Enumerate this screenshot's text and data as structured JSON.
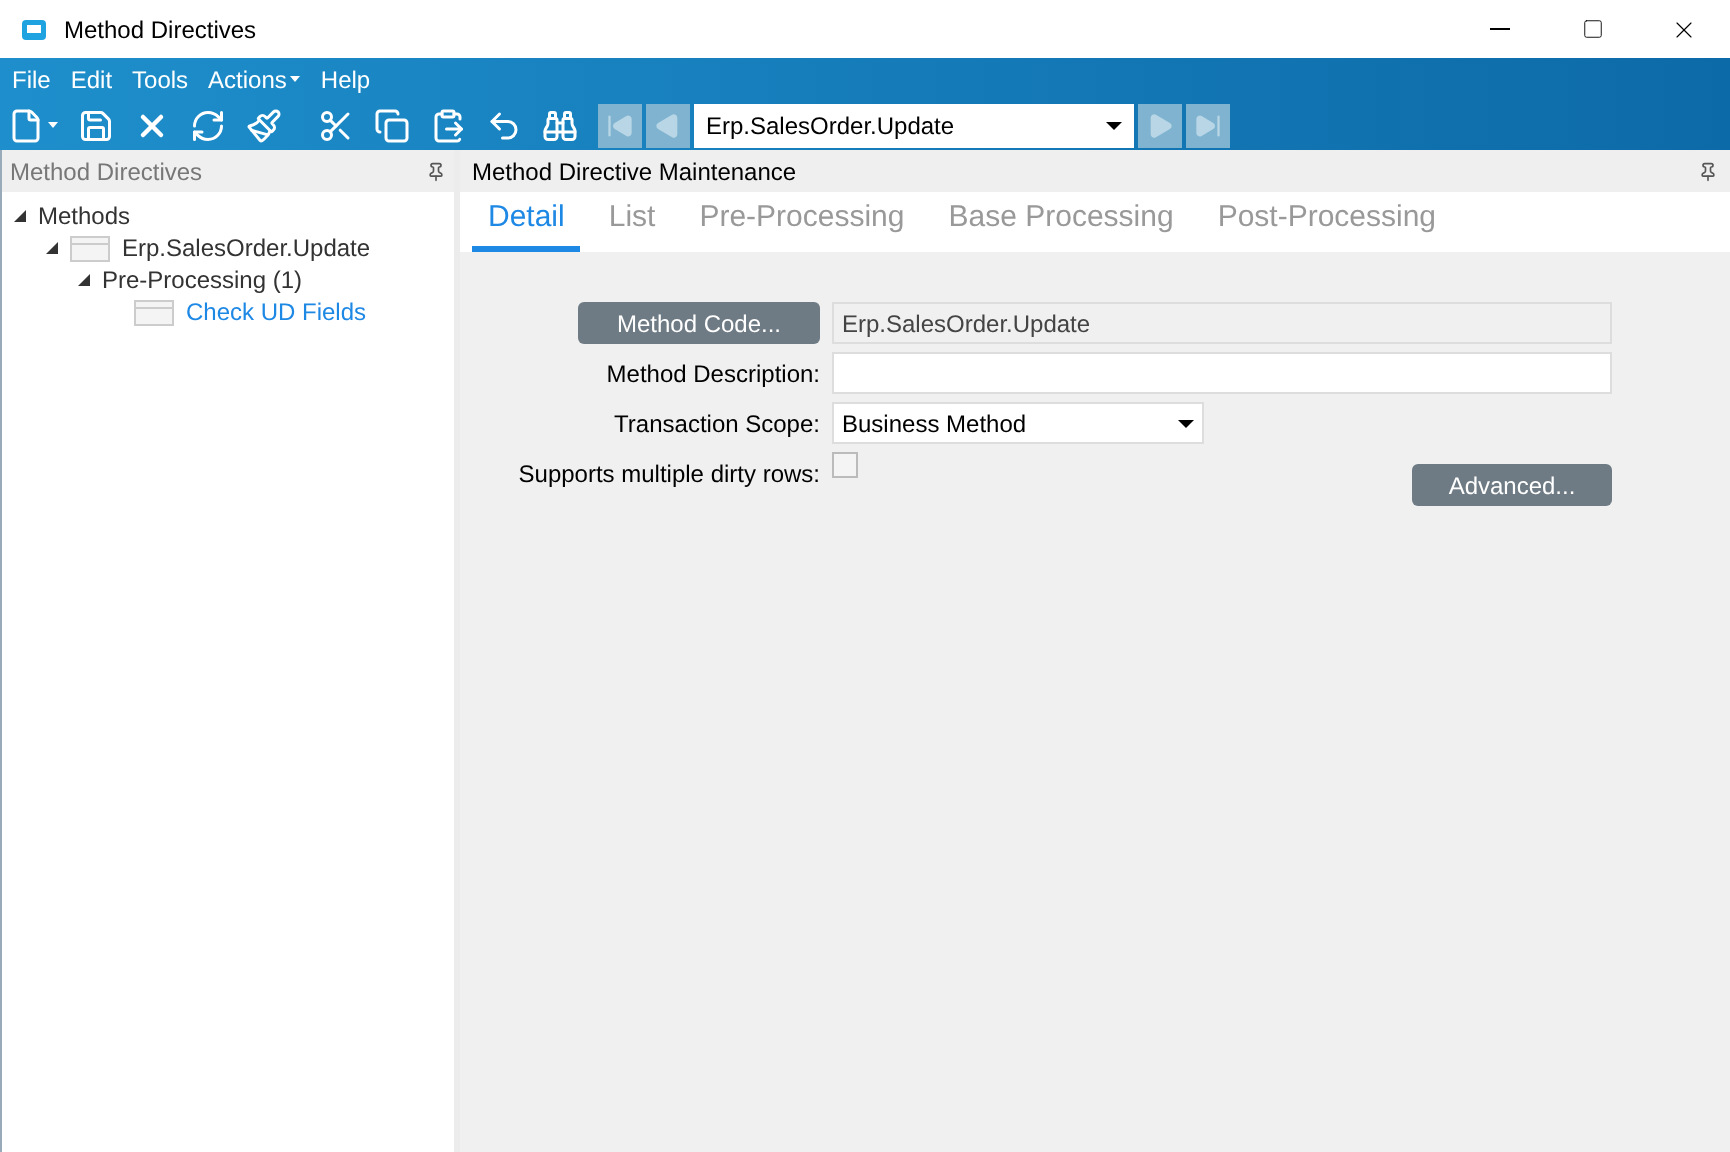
{
  "window": {
    "title": "Method Directives"
  },
  "menu": [
    "File",
    "Edit",
    "Tools",
    "Actions",
    "Help"
  ],
  "toolbar": {
    "record": "Erp.SalesOrder.Update"
  },
  "left_panel": {
    "title": "Method Directives",
    "tree": [
      {
        "label": "Methods",
        "expanded": true,
        "selected": false,
        "children": [
          {
            "label": "Erp.SalesOrder.Update",
            "expanded": true,
            "folder": true,
            "selected": false,
            "children": [
              {
                "label": "Pre-Processing (1)",
                "expanded": true,
                "selected": false,
                "children": [
                  {
                    "label": "Check UD Fields",
                    "folder": true,
                    "selected": true
                  }
                ]
              }
            ]
          }
        ]
      }
    ]
  },
  "right_panel": {
    "title": "Method Directive Maintenance",
    "tabs": [
      {
        "label": "Detail",
        "selected": true
      },
      {
        "label": "List",
        "selected": false
      },
      {
        "label": "Pre-Processing",
        "selected": false
      },
      {
        "label": "Base Processing",
        "selected": false
      },
      {
        "label": "Post-Processing",
        "selected": false
      }
    ],
    "form": {
      "method_code_button": "Method Code...",
      "method_code": "Erp.SalesOrder.Update",
      "description_label": "Method Description:",
      "scope_label": "Transaction Scope:",
      "scope": "Business Method",
      "dirty_rows_label": "Supports multiple dirty rows:",
      "dirty_rows_checked": false,
      "advanced_button": "Advanced..."
    }
  }
}
